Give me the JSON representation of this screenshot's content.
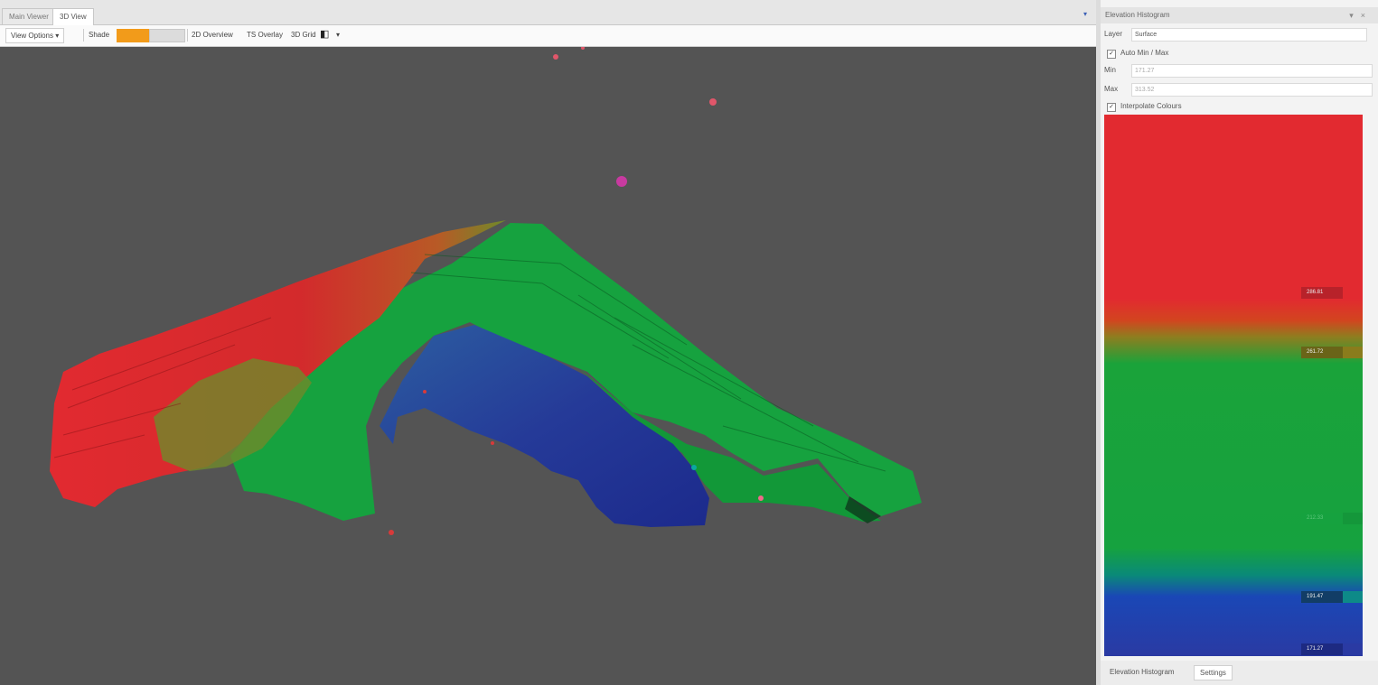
{
  "tabs": [
    {
      "label": "Main Viewer"
    },
    {
      "label": "3D View"
    }
  ],
  "toolbar": {
    "view_options": "View Options",
    "shade_label": "Shade",
    "item_2d_overview": "2D Overview",
    "item_ts_overlay": "TS Overlay",
    "item_3d_grid": "3D Grid",
    "chevron": "▾",
    "colors": {
      "shade_orange": "#f29b1a",
      "shade_grey": "#d9d9d9"
    }
  },
  "viewport": {
    "background": "#545454",
    "surface_colors": {
      "red": "#e22a30",
      "green": "#16a23f",
      "blue": "#23389c",
      "yellow": "#8f7d1f"
    }
  },
  "panel": {
    "title": "Elevation Histogram",
    "header_buttons": [
      "▾",
      "×"
    ],
    "layer_label": "Layer",
    "layer_value": "Surface",
    "min_max_label": "Auto Min / Max",
    "min_label": "Min",
    "min_value": "171.27",
    "max_label": "Max",
    "max_value": "313.52",
    "interpolate_label": "Interpolate Colours",
    "markers": [
      {
        "value": "286.81",
        "color": "#c2262b"
      },
      {
        "value": "261.72",
        "color": "#8a7c1c"
      },
      {
        "value": "212.33",
        "color": "#16a23f"
      },
      {
        "value": "191.47",
        "color": "#13807a"
      },
      {
        "value": "171.27",
        "color": "#2a3aa3"
      }
    ],
    "bottom_tabs": [
      {
        "label": "Elevation Histogram"
      },
      {
        "label": "Settings"
      }
    ]
  }
}
